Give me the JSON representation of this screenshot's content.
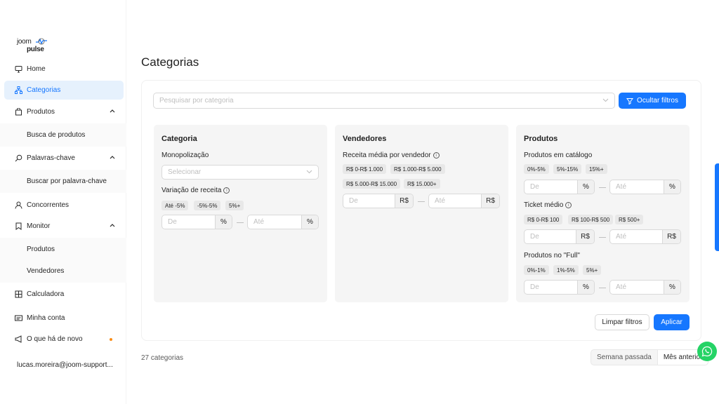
{
  "logo": {
    "line1": "joom",
    "line2": "pulse"
  },
  "sidebar": {
    "home": "Home",
    "categorias": "Categorias",
    "produtos": "Produtos",
    "busca_produtos": "Busca de produtos",
    "palavras": "Palavras-chave",
    "buscar_palavra": "Buscar por palavra-chave",
    "concorrentes": "Concorrentes",
    "monitor": "Monitor",
    "monitor_produtos": "Produtos",
    "monitor_vendedores": "Vendedores",
    "calculadora": "Calculadora",
    "minha_conta": "Minha conta",
    "novo": "O que há de novo",
    "user": "lucas.moreira@joom-support..."
  },
  "page": {
    "title": "Categorias"
  },
  "filters": {
    "search_placeholder": "Pesquisar por categoria",
    "hide_button": "Ocultar filtros",
    "clear_button": "Limpar filtros",
    "apply_button": "Aplicar",
    "from_placeholder": "De",
    "to_placeholder": "Até",
    "pct": "%",
    "brl": "R$",
    "categoria": {
      "title": "Categoria",
      "mono_label": "Monopolização",
      "mono_placeholder": "Selecionar",
      "var_label": "Variação de receita",
      "var_tags": [
        "Até -5%",
        "-5%-5%",
        "5%+"
      ]
    },
    "vendedores": {
      "title": "Vendedores",
      "receita_label": "Receita média por vendedor",
      "receita_tags": [
        "R$ 0-R$ 1.000",
        "R$ 1.000-R$ 5.000",
        "R$ 5.000-R$ 15.000",
        "R$ 15.000+"
      ]
    },
    "produtos": {
      "title": "Produtos",
      "catalogo_label": "Produtos em catálogo",
      "catalogo_tags": [
        "0%-5%",
        "5%-15%",
        "15%+"
      ],
      "ticket_label": "Ticket médio",
      "ticket_tags": [
        "R$ 0-R$ 100",
        "R$ 100-R$ 500",
        "R$ 500+"
      ],
      "full_label": "Produtos no \"Full\"",
      "full_tags": [
        "0%-1%",
        "1%-5%",
        "5%+"
      ]
    }
  },
  "results": {
    "count": "27 categorias"
  },
  "period": {
    "last_week": "Semana passada",
    "last_month": "Mês anterior"
  },
  "colors": {
    "primary": "#1677ff",
    "whatsapp": "#25d366",
    "badge": "#fa8c16"
  }
}
